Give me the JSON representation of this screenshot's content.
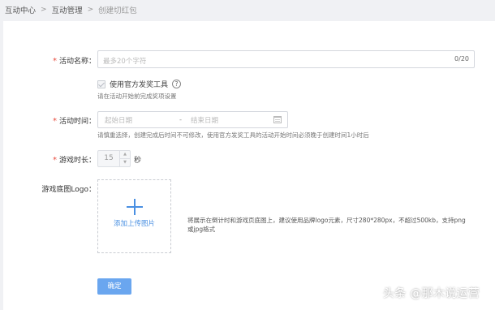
{
  "breadcrumb": {
    "items": [
      "互动中心",
      "互动管理"
    ],
    "current": "创建切红包",
    "separator": ">"
  },
  "form": {
    "name": {
      "label": "活动名称：",
      "required_mark": "*",
      "placeholder": "最多20个字符",
      "value": "",
      "counter": "0/20"
    },
    "official_tool": {
      "checkbox_label": "使用官方发奖工具",
      "checked": true,
      "disabled": true,
      "help_glyph": "?",
      "hint": "请在活动开始前完成奖项设置"
    },
    "time": {
      "label": "活动时间：",
      "required_mark": "*",
      "start_placeholder": "起始日期",
      "separator": "-",
      "end_placeholder": "结束日期",
      "hint": "请慎重选择，创建完成后时间不可修改，使用官方发奖工具的活动开始时间必须晚于创建时间1小时后"
    },
    "duration": {
      "label": "游戏时长：",
      "required_mark": "*",
      "value": "15",
      "up_arrow": "▲",
      "down_arrow": "▼",
      "unit": "秒"
    },
    "logo": {
      "label": "游戏底图Logo：",
      "upload_label": "添加上传图片",
      "note": "将展示在倒计时和游戏页底图上，建议使用品牌logo元素，尺寸280*280px，不超过500kb，支持png或jpg格式"
    },
    "submit_label": "确定"
  },
  "watermark": "头条 @那木说运营",
  "colors": {
    "accent": "#4a90e2",
    "button": "#6aa6ef",
    "required": "#e84a3c",
    "background": "#f0f1f4"
  }
}
